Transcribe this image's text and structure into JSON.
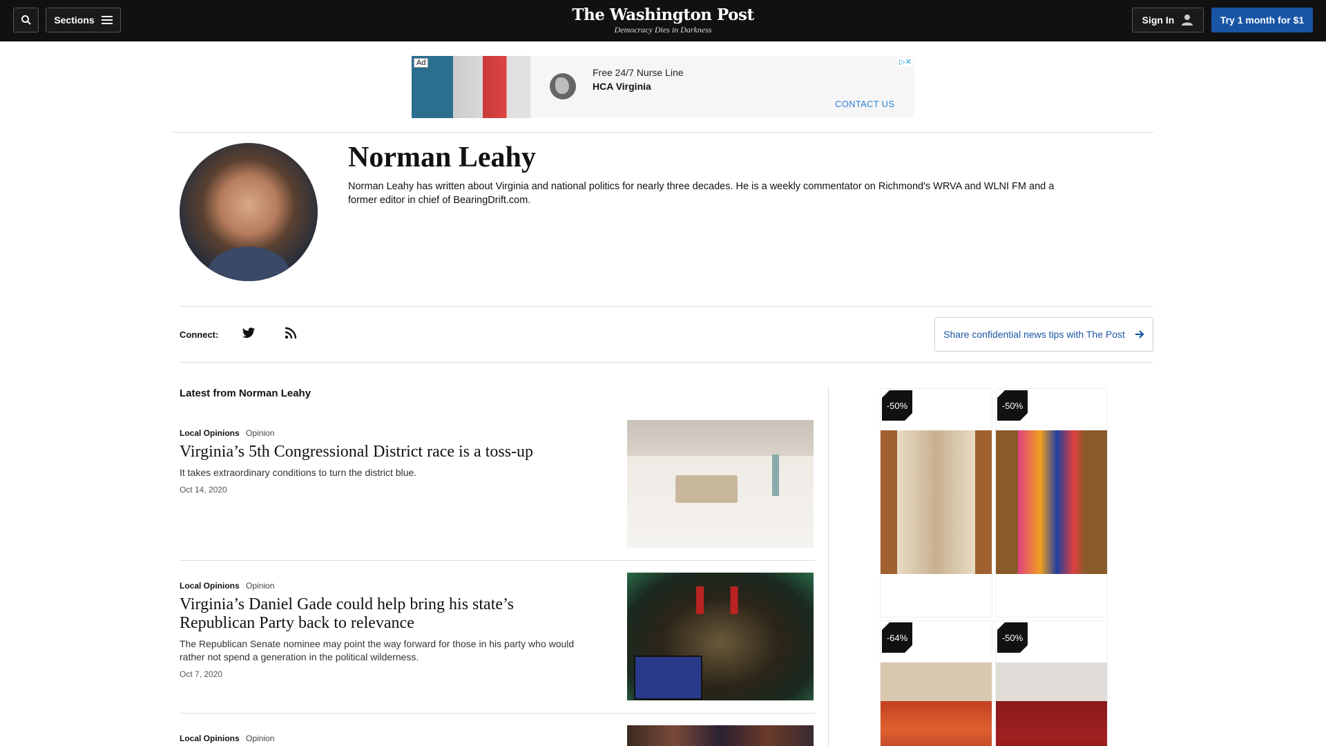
{
  "nav": {
    "sections_label": "Sections",
    "logo": "The Washington Post",
    "tagline": "Democracy Dies in Darkness",
    "signin_label": "Sign In",
    "try_label": "Try 1 month for $1"
  },
  "top_ad": {
    "ad_label": "Ad",
    "line1": "Free 24/7 Nurse Line",
    "line2": "HCA Virginia",
    "cta": "CONTACT US"
  },
  "author": {
    "name": "Norman Leahy",
    "bio": "Norman Leahy has written about Virginia and national politics for nearly three decades. He is a weekly commentator on Richmond's WRVA and WLNI FM and a former editor in chief of BearingDrift.com."
  },
  "connect": {
    "label": "Connect:",
    "tips_label": "Share confidential news tips with The Post"
  },
  "latest": {
    "heading": "Latest from Norman Leahy",
    "articles": [
      {
        "section": "Local Opinions",
        "label": "Opinion",
        "headline": "Virginia’s 5th Congressional District race is a toss-up",
        "blurb": "It takes extraordinary conditions to turn the district blue.",
        "date": "Oct 14, 2020"
      },
      {
        "section": "Local Opinions",
        "label": "Opinion",
        "headline": "Virginia’s Daniel Gade could help bring his state’s Republican Party back to relevance",
        "blurb": "The Republican Senate nominee may point the way forward for those in his party who would rather not spend a generation in the political wilderness.",
        "date": "Oct 7, 2020"
      },
      {
        "section": "Local Opinions",
        "label": "Opinion"
      }
    ]
  },
  "side_ad": {
    "tiles": [
      {
        "discount": "-50%"
      },
      {
        "discount": "-50%"
      },
      {
        "discount": "-64%"
      },
      {
        "discount": "-50%"
      }
    ]
  }
}
